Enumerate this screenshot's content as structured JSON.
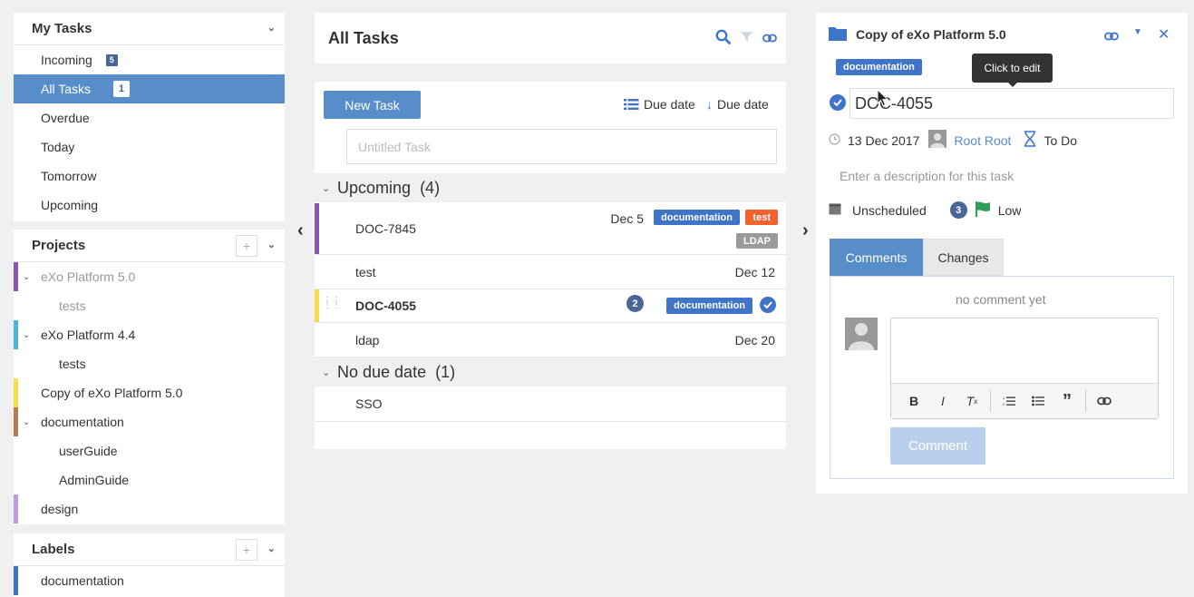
{
  "my_tasks": {
    "title": "My Tasks",
    "items": [
      {
        "label": "Incoming",
        "badge": "5"
      },
      {
        "label": "All Tasks",
        "badge": "1"
      },
      {
        "label": "Overdue"
      },
      {
        "label": "Today"
      },
      {
        "label": "Tomorrow"
      },
      {
        "label": "Upcoming"
      }
    ]
  },
  "projects": {
    "title": "Projects",
    "add": "+",
    "items": [
      {
        "label": "eXo Platform 5.0",
        "color": "#8a55b5"
      },
      {
        "label": "tests"
      },
      {
        "label": "eXo Platform 4.4",
        "color": "#4ab8d6"
      },
      {
        "label": "tests"
      },
      {
        "label": "Copy of eXo Platform 5.0",
        "color": "#f5de4a"
      },
      {
        "label": "documentation",
        "color": "#b07d55"
      },
      {
        "label": "userGuide"
      },
      {
        "label": "AdminGuide"
      },
      {
        "label": "design",
        "color": "#c49ae0"
      }
    ]
  },
  "labels": {
    "title": "Labels",
    "add": "+",
    "items": [
      {
        "label": "documentation",
        "color": "#3f74c9"
      }
    ]
  },
  "main": {
    "title": "All Tasks",
    "new_task": "New Task",
    "sort1": "Due date",
    "sort2": "Due date",
    "new_task_placeholder": "Untitled Task",
    "groups": [
      {
        "label": "Upcoming",
        "count": "(4)"
      },
      {
        "label": "No due date",
        "count": "(1)"
      }
    ],
    "tasks": [
      {
        "name": "DOC-7845",
        "date": "Dec 5",
        "tags": [
          "documentation",
          "test",
          "LDAP"
        ]
      },
      {
        "name": "test",
        "date": "Dec 12"
      },
      {
        "name": "DOC-4055",
        "comments": "2",
        "tags": [
          "documentation"
        ]
      },
      {
        "name": "ldap",
        "date": "Dec 20"
      },
      {
        "name": "SSO"
      }
    ],
    "prev_arrow": "‹",
    "next_arrow": "›"
  },
  "detail": {
    "project": "Copy of eXo Platform 5.0",
    "tag": "documentation",
    "tooltip": "Click to edit",
    "task_title": "DOC-4055",
    "due_date": "13 Dec 2017",
    "assignee": "Root Root",
    "status": "To Do",
    "description_placeholder": "Enter a description for this task",
    "schedule": "Unscheduled",
    "comments_count": "3",
    "priority": "Low",
    "tab_comments": "Comments",
    "tab_changes": "Changes",
    "no_comment": "no comment yet",
    "comment_button": "Comment",
    "colors": {
      "accent": "#578dc9",
      "flag": "#2e9e5a"
    }
  }
}
